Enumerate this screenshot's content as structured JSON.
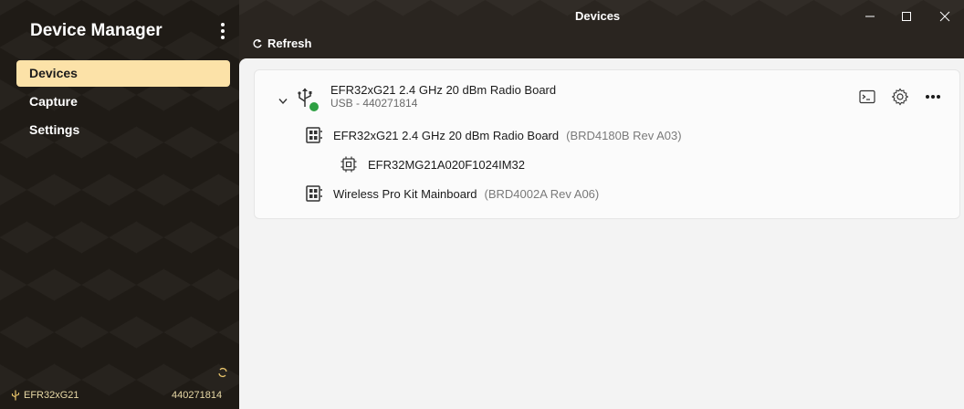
{
  "app": {
    "title": "Device Manager",
    "window_title": "Devices",
    "refresh_label": "Refresh"
  },
  "nav": {
    "items": [
      {
        "label": "Devices",
        "active": true
      },
      {
        "label": "Capture",
        "active": false
      },
      {
        "label": "Settings",
        "active": false
      }
    ]
  },
  "device": {
    "name": "EFR32xG21 2.4 GHz 20 dBm Radio Board",
    "connection": "USB - 440271814",
    "status_color": "#2ea043",
    "children": [
      {
        "name": "EFR32xG21 2.4 GHz 20 dBm Radio Board",
        "detail": "(BRD4180B Rev A03)",
        "icon": "board-icon"
      },
      {
        "name": "EFR32MG21A020F1024IM32",
        "detail": "",
        "icon": "chip-icon"
      },
      {
        "name": "Wireless Pro Kit Mainboard",
        "detail": "(BRD4002A Rev A06)",
        "icon": "board-icon"
      }
    ]
  },
  "footer": {
    "device_label": "EFR32xG21",
    "serial": "440271814"
  },
  "colors": {
    "accent": "#fce2a8",
    "sidebar_bg": "#1f1b16",
    "content_bg": "#f3f3f3"
  }
}
